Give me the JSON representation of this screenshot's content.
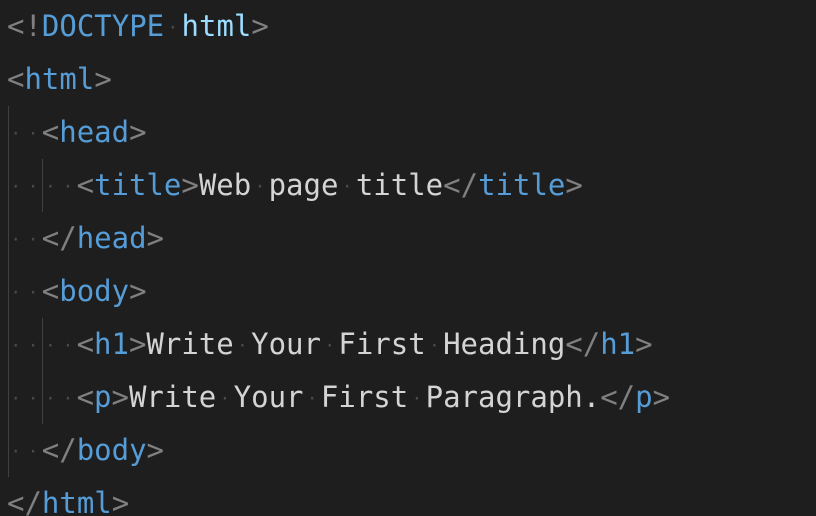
{
  "editor": {
    "language": "html",
    "lines": [
      {
        "indent": 0,
        "parts": [
          {
            "kind": "punct",
            "text": "<!"
          },
          {
            "kind": "doctype",
            "text": "DOCTYPE"
          },
          {
            "kind": "space"
          },
          {
            "kind": "doctype-attr",
            "text": "html"
          },
          {
            "kind": "punct",
            "text": ">"
          }
        ]
      },
      {
        "indent": 0,
        "parts": [
          {
            "kind": "punct",
            "text": "<"
          },
          {
            "kind": "tag",
            "text": "html"
          },
          {
            "kind": "punct",
            "text": ">"
          }
        ]
      },
      {
        "indent": 1,
        "parts": [
          {
            "kind": "punct",
            "text": "<"
          },
          {
            "kind": "tag",
            "text": "head"
          },
          {
            "kind": "punct",
            "text": ">"
          }
        ]
      },
      {
        "indent": 2,
        "parts": [
          {
            "kind": "punct",
            "text": "<"
          },
          {
            "kind": "tag",
            "text": "title"
          },
          {
            "kind": "punct",
            "text": ">"
          },
          {
            "kind": "text",
            "text": "Web"
          },
          {
            "kind": "space"
          },
          {
            "kind": "text",
            "text": "page"
          },
          {
            "kind": "space"
          },
          {
            "kind": "text",
            "text": "title"
          },
          {
            "kind": "punct",
            "text": "</"
          },
          {
            "kind": "tag",
            "text": "title"
          },
          {
            "kind": "punct",
            "text": ">"
          }
        ]
      },
      {
        "indent": 1,
        "parts": [
          {
            "kind": "punct",
            "text": "</"
          },
          {
            "kind": "tag",
            "text": "head"
          },
          {
            "kind": "punct",
            "text": ">"
          }
        ]
      },
      {
        "indent": 1,
        "parts": [
          {
            "kind": "punct",
            "text": "<"
          },
          {
            "kind": "tag",
            "text": "body"
          },
          {
            "kind": "punct",
            "text": ">"
          }
        ]
      },
      {
        "indent": 2,
        "parts": [
          {
            "kind": "punct",
            "text": "<"
          },
          {
            "kind": "tag",
            "text": "h1"
          },
          {
            "kind": "punct",
            "text": ">"
          },
          {
            "kind": "text",
            "text": "Write"
          },
          {
            "kind": "space"
          },
          {
            "kind": "text",
            "text": "Your"
          },
          {
            "kind": "space"
          },
          {
            "kind": "text",
            "text": "First"
          },
          {
            "kind": "space"
          },
          {
            "kind": "text",
            "text": "Heading"
          },
          {
            "kind": "punct",
            "text": "</"
          },
          {
            "kind": "tag",
            "text": "h1"
          },
          {
            "kind": "punct",
            "text": ">"
          }
        ]
      },
      {
        "indent": 2,
        "parts": [
          {
            "kind": "punct",
            "text": "<"
          },
          {
            "kind": "tag",
            "text": "p"
          },
          {
            "kind": "punct",
            "text": ">"
          },
          {
            "kind": "text",
            "text": "Write"
          },
          {
            "kind": "space"
          },
          {
            "kind": "text",
            "text": "Your"
          },
          {
            "kind": "space"
          },
          {
            "kind": "text",
            "text": "First"
          },
          {
            "kind": "space"
          },
          {
            "kind": "text",
            "text": "Paragraph."
          },
          {
            "kind": "punct",
            "text": "</"
          },
          {
            "kind": "tag",
            "text": "p"
          },
          {
            "kind": "punct",
            "text": ">"
          }
        ]
      },
      {
        "indent": 1,
        "parts": [
          {
            "kind": "punct",
            "text": "</"
          },
          {
            "kind": "tag",
            "text": "body"
          },
          {
            "kind": "punct",
            "text": ">"
          }
        ]
      },
      {
        "indent": 0,
        "parts": [
          {
            "kind": "punct",
            "text": "</"
          },
          {
            "kind": "tag",
            "text": "html"
          },
          {
            "kind": "punct",
            "text": ">"
          }
        ]
      }
    ]
  },
  "colors": {
    "background": "#1e1e1e",
    "punctuation": "#808080",
    "tag": "#569cd6",
    "doctype_attr": "#9cdcfe",
    "text": "#d4d4d4",
    "whitespace_dot": "#4a4a4a",
    "indent_guide": "#404040"
  }
}
